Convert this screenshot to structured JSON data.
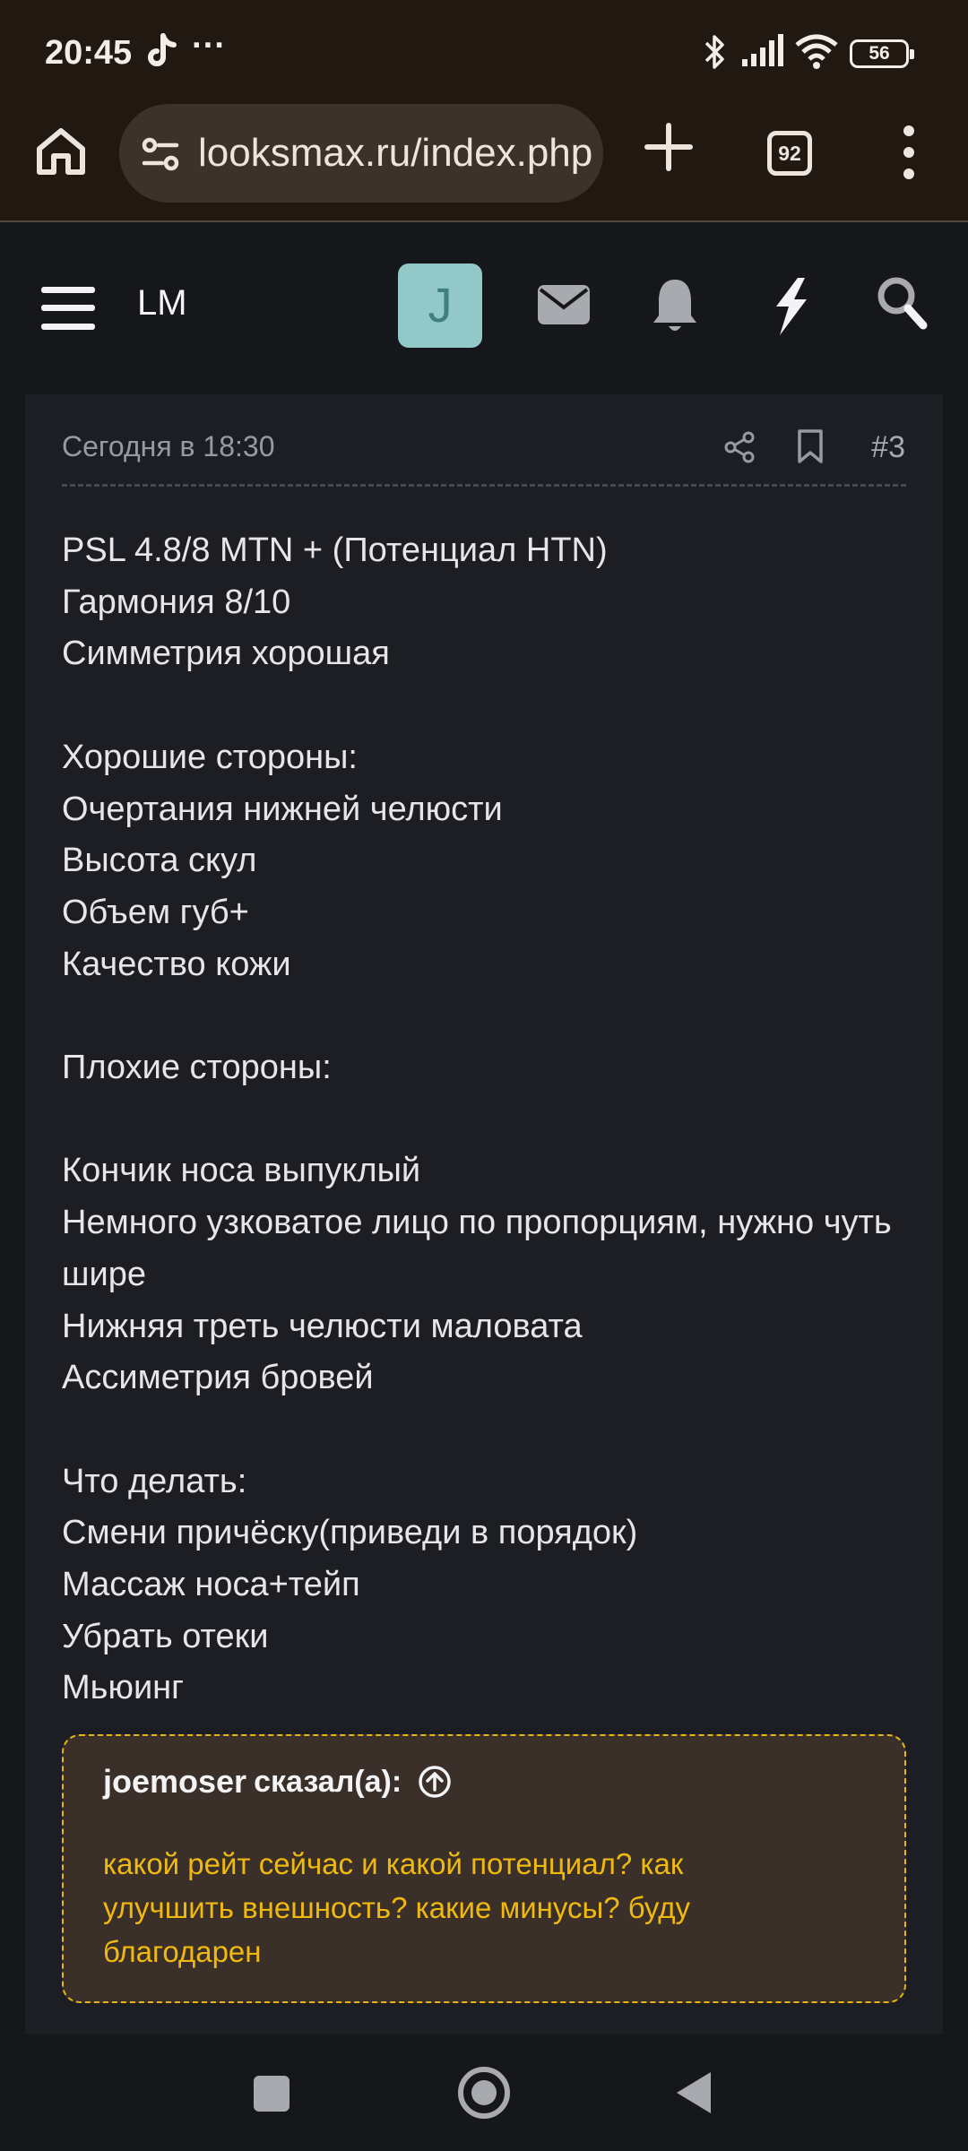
{
  "status_bar": {
    "time": "20:45",
    "more_glyph": "···",
    "battery_level": "56",
    "icons": [
      "tiktok-icon",
      "bluetooth-icon",
      "signal-icon",
      "wifi-icon",
      "battery-icon"
    ]
  },
  "browser": {
    "url": "looksmax.ru/index.php",
    "tab_count": "92"
  },
  "site_header": {
    "logo": "LM",
    "avatar_letter": "J"
  },
  "post": {
    "timestamp": "Сегодня в 18:30",
    "number": "#3",
    "body": "PSL 4.8/8 MTN + (Потенциал HTN)\nГармония 8/10\nСимметрия хорошая\n\nХорошие стороны:\nОчертания нижней челюсти\nВысота скул\nОбъем губ+\nКачество кожи\n\nПлохие стороны:\n\nКончик носа выпуклый\nНемного узковатое лицо по пропорциям, нужно чуть шире\nНижняя треть челюсти маловата\nАссиметрия бровей\n\nЧто делать:\nСмени причёску(приведи в порядок)\nМассаж носа+тейп\nУбрать отеки\nМьюинг",
    "quote": {
      "author": "joemoser",
      "said": "сказал(а):",
      "text": "какой рейт сейчас и какой потенциал? как улучшить внешность? какие минусы? буду благодарен"
    }
  },
  "colors": {
    "browser_bg": "#211812",
    "page_bg": "#16171b",
    "post_bg": "#1d1e23",
    "avatar_bg": "#92c8c8",
    "quote_bg": "#3a3029",
    "quote_accent": "#f0b90f"
  }
}
